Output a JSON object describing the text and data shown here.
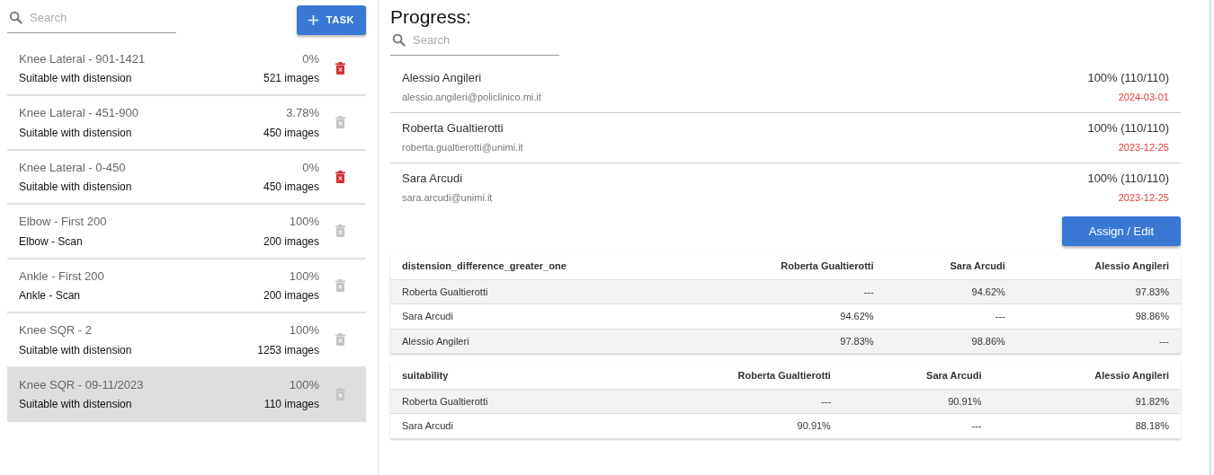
{
  "task_panel": {
    "search": {
      "placeholder": "Search"
    },
    "add_button": {
      "label": "TASK"
    },
    "tasks": [
      {
        "title": "Knee Lateral - 901-1421",
        "subtitle": "Suitable with distension",
        "percent": "0%",
        "images": "521 images",
        "deletable": true,
        "selected": false
      },
      {
        "title": "Knee Lateral - 451-900",
        "subtitle": "Suitable with distension",
        "percent": "3.78%",
        "images": "450 images",
        "deletable": false,
        "selected": false
      },
      {
        "title": "Knee Lateral - 0-450",
        "subtitle": "Suitable with distension",
        "percent": "0%",
        "images": "450 images",
        "deletable": true,
        "selected": false
      },
      {
        "title": "Elbow - First 200",
        "subtitle": "Elbow - Scan",
        "percent": "100%",
        "images": "200 images",
        "deletable": false,
        "selected": false
      },
      {
        "title": "Ankle - First 200",
        "subtitle": "Ankle - Scan",
        "percent": "100%",
        "images": "200 images",
        "deletable": false,
        "selected": false
      },
      {
        "title": "Knee SQR - 2",
        "subtitle": "Suitable with distension",
        "percent": "100%",
        "images": "1253 images",
        "deletable": false,
        "selected": false
      },
      {
        "title": "Knee SQR - 09-11/2023",
        "subtitle": "Suitable with distension",
        "percent": "100%",
        "images": "110 images",
        "deletable": false,
        "selected": true
      }
    ]
  },
  "progress_panel": {
    "title": "Progress:",
    "search": {
      "placeholder": "Search"
    },
    "users": [
      {
        "name": "Alessio Angileri",
        "email": "alessio.angileri@policlinico.mi.it",
        "progress": "100% (110/110)",
        "date": "2024-03-01"
      },
      {
        "name": "Roberta Gualtierotti",
        "email": "roberta.gualtierotti@unimi.it",
        "progress": "100% (110/110)",
        "date": "2023-12-25"
      },
      {
        "name": "Sara Arcudi",
        "email": "sara.arcudi@unimi.it",
        "progress": "100% (110/110)",
        "date": "2023-12-25"
      }
    ],
    "assign_button": {
      "label": "Assign / Edit"
    },
    "tables": [
      {
        "columns": [
          "distension_difference_greater_one",
          "Roberta Gualtierotti",
          "Sara Arcudi",
          "Alessio Angileri"
        ],
        "rows": [
          [
            "Roberta Gualtierotti",
            "---",
            "94.62%",
            "97.83%"
          ],
          [
            "Sara Arcudi",
            "94.62%",
            "---",
            "98.86%"
          ],
          [
            "Alessio Angileri",
            "97.83%",
            "98.86%",
            "---"
          ]
        ]
      },
      {
        "columns": [
          "suitability",
          "Roberta Gualtierotti",
          "Sara Arcudi",
          "Alessio Angileri"
        ],
        "rows": [
          [
            "Roberta Gualtierotti",
            "---",
            "90.91%",
            "91.82%"
          ],
          [
            "Sara Arcudi",
            "90.91%",
            "---",
            "88.18%"
          ]
        ]
      }
    ]
  }
}
